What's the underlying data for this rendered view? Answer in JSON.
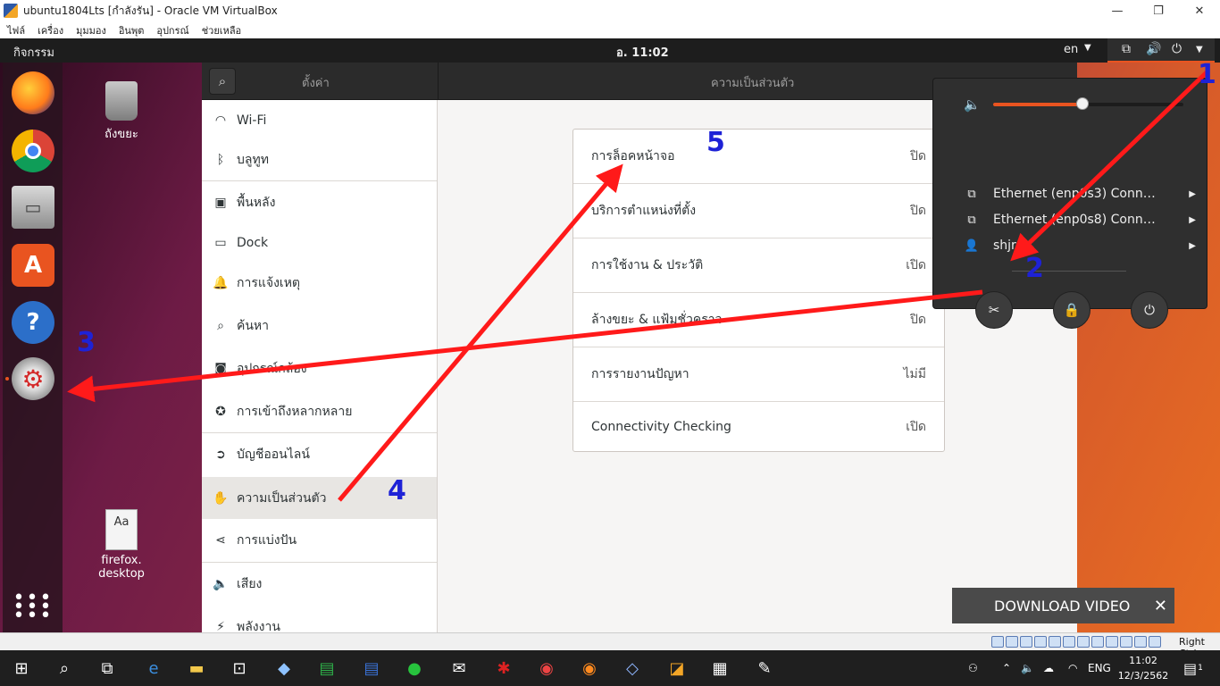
{
  "vbox": {
    "title": "ubuntu1804Lts [กำลังรัน] - Oracle VM VirtualBox",
    "menu": [
      "ไฟล์",
      "เครื่อง",
      "มุมมอง",
      "อินพุต",
      "อุปกรณ์",
      "ช่วยเหลือ"
    ],
    "status_right": "Right Ctrl"
  },
  "topbar": {
    "activities": "กิจกรรม",
    "clock": "อ. 11:02",
    "lang": "en"
  },
  "desktop": {
    "trash_label": "ถังขยะ",
    "file_label_1": "firefox.",
    "file_label_2": "desktop"
  },
  "settings": {
    "left_title": "ตั้งค่า",
    "right_title": "ความเป็นส่วนตัว",
    "sidebar": [
      {
        "label": "Wi-Fi",
        "icon": "wifi-icon"
      },
      {
        "label": "บลูทูท",
        "icon": "bluetooth-icon"
      },
      {
        "label": "พื้นหลัง",
        "icon": "background-icon"
      },
      {
        "label": "Dock",
        "icon": "dock-icon"
      },
      {
        "label": "การแจ้งเหตุ",
        "icon": "bell-icon"
      },
      {
        "label": "ค้นหา",
        "icon": "search-icon"
      },
      {
        "label": "อุปกรณ์กล้อง",
        "icon": "camera-icon"
      },
      {
        "label": "การเข้าถึงหลากหลาย",
        "icon": "accessibility-icon"
      },
      {
        "label": "บัญชีออนไลน์",
        "icon": "online-accounts-icon"
      },
      {
        "label": "ความเป็นส่วนตัว",
        "icon": "hand-icon"
      },
      {
        "label": "การแบ่งปัน",
        "icon": "share-icon"
      },
      {
        "label": "เสียง",
        "icon": "sound-icon"
      },
      {
        "label": "พลังงาน",
        "icon": "power-icon"
      }
    ],
    "privacy_rows": [
      {
        "label": "การล็อคหน้าจอ",
        "state": "ปิด"
      },
      {
        "label": "บริการตำแหน่งที่ตั้ง",
        "state": "ปิด"
      },
      {
        "label": "การใช้งาน & ประวัติ",
        "state": "เปิด"
      },
      {
        "label": "ล้างขยะ & แฟ้มชั่วคราว",
        "state": "ปิด"
      },
      {
        "label": "การรายงานปัญหา",
        "state": "ไม่มี"
      },
      {
        "label": "Connectivity Checking",
        "state": "เปิด"
      }
    ]
  },
  "system_menu": {
    "volume": 0.47,
    "rows": [
      {
        "label": "Ethernet (enp0s3) Conn…",
        "icon": "network-icon"
      },
      {
        "label": "Ethernet (enp0s8) Conn…",
        "icon": "network-icon"
      },
      {
        "label": "shjr",
        "icon": "user-icon"
      }
    ]
  },
  "download_video": "DOWNLOAD VIDEO",
  "annotations": [
    "1",
    "2",
    "3",
    "4",
    "5"
  ],
  "taskbar": {
    "lang": "ENG",
    "time": "11:02",
    "date": "12/3/2562",
    "notif_count": "1"
  },
  "colors": {
    "accent": "#e95420",
    "annotation_arrow": "#ff1a1a",
    "annotation_number": "#1e22d6"
  }
}
